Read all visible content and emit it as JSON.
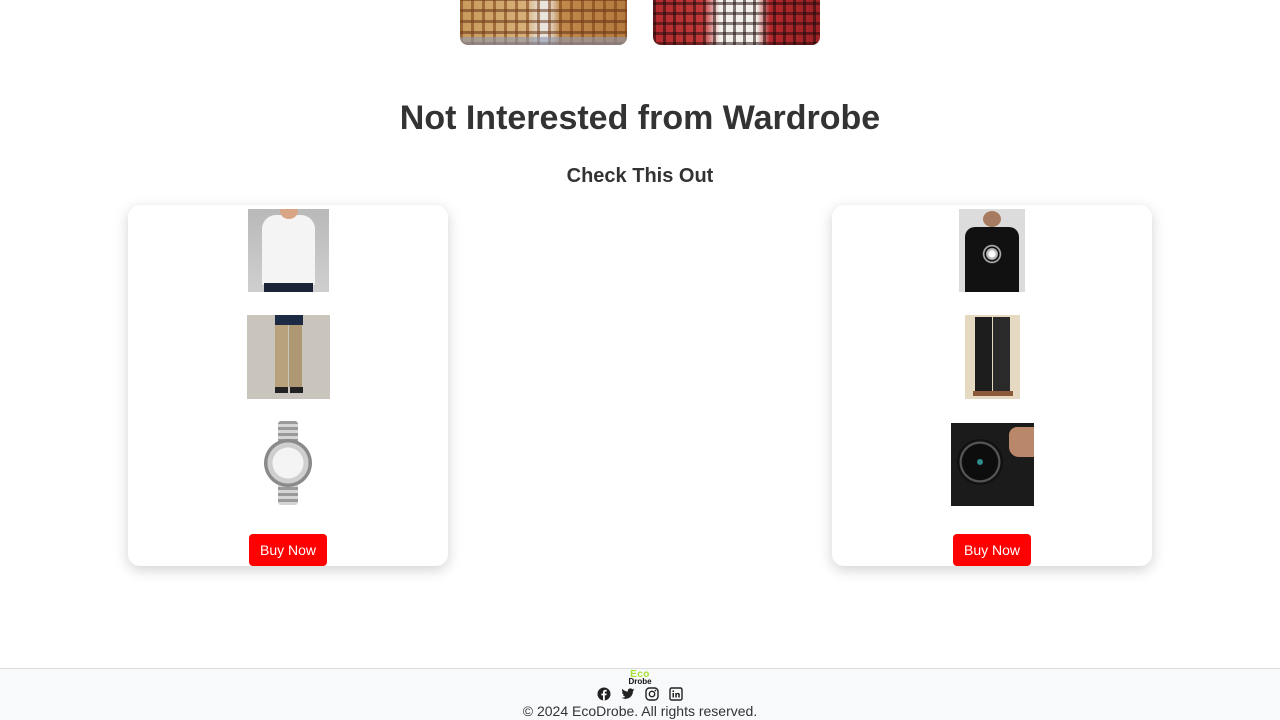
{
  "section": {
    "title": "Not Interested from Wardrobe",
    "subtitle": "Check This Out"
  },
  "cards": [
    {
      "items": [
        "white-shirt",
        "khaki-pants",
        "silver-watch"
      ],
      "button_label": "Buy Now"
    },
    {
      "items": [
        "black-tshirt",
        "black-pants",
        "black-watch"
      ],
      "button_label": "Buy Now"
    }
  ],
  "footer": {
    "logo_line1": "Eco",
    "logo_line2": "Drobe",
    "socials": [
      "facebook-icon",
      "twitter-icon",
      "instagram-icon",
      "linkedin-icon"
    ],
    "copyright": "© 2024 EcoDrobe. All rights reserved."
  },
  "colors": {
    "button": "#ff0000",
    "title": "#333333",
    "logo_accent": "#a6e22e"
  }
}
